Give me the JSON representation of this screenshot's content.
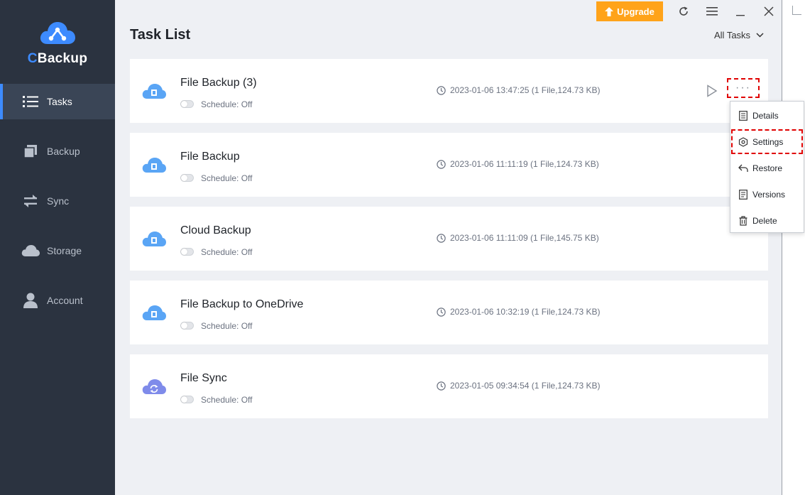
{
  "app": {
    "logo_prefix": "C",
    "logo_rest": "Backup"
  },
  "sidebar": {
    "items": [
      {
        "label": "Tasks",
        "icon": "list-icon",
        "active": true
      },
      {
        "label": "Backup",
        "icon": "backup-icon",
        "active": false
      },
      {
        "label": "Sync",
        "icon": "sync-icon",
        "active": false
      },
      {
        "label": "Storage",
        "icon": "cloud-icon",
        "active": false
      },
      {
        "label": "Account",
        "icon": "user-icon",
        "active": false
      }
    ]
  },
  "header": {
    "upgrade_label": "Upgrade",
    "title": "Task List",
    "filter_label": "All Tasks"
  },
  "tasks": [
    {
      "name": "File Backup (3)",
      "schedule": "Schedule: Off",
      "time": "2023-01-06 13:47:25 (1 File,124.73 KB)",
      "icon": "cloud-backup-icon"
    },
    {
      "name": "File Backup",
      "schedule": "Schedule: Off",
      "time": "2023-01-06 11:11:19 (1 File,124.73 KB)",
      "icon": "cloud-backup-icon"
    },
    {
      "name": "Cloud Backup",
      "schedule": "Schedule: Off",
      "time": "2023-01-06 11:11:09 (1 File,145.75 KB)",
      "icon": "cloud-backup-icon"
    },
    {
      "name": "File Backup to OneDrive",
      "schedule": "Schedule: Off",
      "time": "2023-01-06 10:32:19 (1 File,124.73 KB)",
      "icon": "cloud-backup-icon"
    },
    {
      "name": "File Sync",
      "schedule": "Schedule: Off",
      "time": "2023-01-05 09:34:54 (1 File,124.73 KB)",
      "icon": "cloud-sync-icon"
    }
  ],
  "menu": {
    "items": [
      {
        "label": "Details",
        "icon": "details-icon"
      },
      {
        "label": "Settings",
        "icon": "settings-icon"
      },
      {
        "label": "Restore",
        "icon": "restore-icon"
      },
      {
        "label": "Versions",
        "icon": "versions-icon"
      },
      {
        "label": "Delete",
        "icon": "trash-icon"
      }
    ]
  },
  "colors": {
    "sidebar_bg": "#2b3340",
    "accent": "#3d8bff",
    "upgrade": "#ffa31a",
    "highlight": "#e00000",
    "sync_cloud": "#7f8bea"
  }
}
